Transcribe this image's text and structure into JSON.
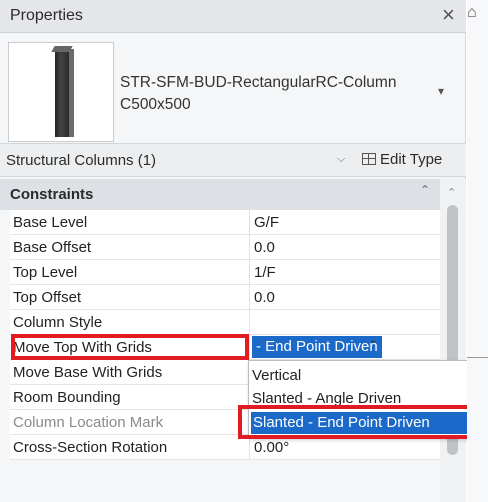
{
  "panel": {
    "title": "Properties",
    "close_icon": "×",
    "type_name_line1": "STR-SFM-BUD-RectangularRC-Column",
    "type_name_line2": "C500x500",
    "type_dropdown_icon": "▾",
    "selector": "Structural Columns (1)",
    "selector_chevron": "⌵",
    "edit_type_label": "Edit Type"
  },
  "section": {
    "title": "Constraints",
    "collapse_icon": "⌃"
  },
  "rows": [
    {
      "label": "Base Level",
      "value": "G/F"
    },
    {
      "label": "Base Offset",
      "value": "0.0"
    },
    {
      "label": "Top Level",
      "value": "1/F"
    },
    {
      "label": "Top Offset",
      "value": "0.0"
    },
    {
      "label": "Column Style",
      "value": "- End Point Driven"
    },
    {
      "label": "Move Top With Grids",
      "value": ""
    },
    {
      "label": "Move Base With Grids",
      "value": ""
    },
    {
      "label": "Room Bounding",
      "value": ""
    },
    {
      "label": "Column Location Mark",
      "value": ""
    },
    {
      "label": "Cross-Section Rotation",
      "value": "0.00°"
    }
  ],
  "column_style_dropdown": {
    "options": [
      "Vertical",
      "Slanted - Angle Driven",
      "Slanted - End Point Driven"
    ],
    "selected": "Slanted - End Point Driven",
    "caret": "⌃"
  },
  "colors": {
    "highlight_blue": "#1b6ac9",
    "annotation_red": "#e01b24"
  },
  "icons": {
    "home": "⌂"
  }
}
